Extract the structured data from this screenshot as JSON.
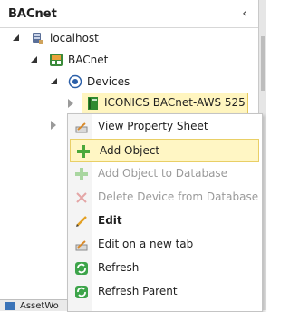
{
  "panel": {
    "title": "BACnet",
    "collapse_glyph": "‹"
  },
  "tree": {
    "items": [
      {
        "label": "localhost",
        "icon": "server-icon"
      },
      {
        "label": "BACnet",
        "icon": "bacnet-icon"
      },
      {
        "label": "Devices",
        "icon": "devices-icon"
      },
      {
        "label": "ICONICS BACnet-AWS 525",
        "icon": "device-book-icon"
      }
    ]
  },
  "context_menu": {
    "items": [
      {
        "label": "View Property Sheet",
        "icon": "property-sheet-icon",
        "enabled": true,
        "bold": false
      },
      {
        "label": "Add Object",
        "icon": "add-icon",
        "enabled": true,
        "bold": false,
        "highlighted": true
      },
      {
        "label": "Add Object to Database",
        "icon": "add-icon",
        "enabled": false,
        "bold": false
      },
      {
        "label": "Delete Device from Database",
        "icon": "delete-icon",
        "enabled": false,
        "bold": false
      },
      {
        "label": "Edit",
        "icon": "pencil-icon",
        "enabled": true,
        "bold": true
      },
      {
        "label": "Edit on a new tab",
        "icon": "edit-tab-icon",
        "enabled": true,
        "bold": false
      },
      {
        "label": "Refresh",
        "icon": "refresh-icon",
        "enabled": true,
        "bold": false
      },
      {
        "label": "Refresh Parent",
        "icon": "refresh-icon",
        "enabled": true,
        "bold": false
      }
    ]
  },
  "bottom_tab": {
    "label": "AssetWo"
  },
  "colors": {
    "accent_green": "#4aa83a",
    "highlight": "#fff6c4",
    "highlight_border": "#e9cf66"
  }
}
